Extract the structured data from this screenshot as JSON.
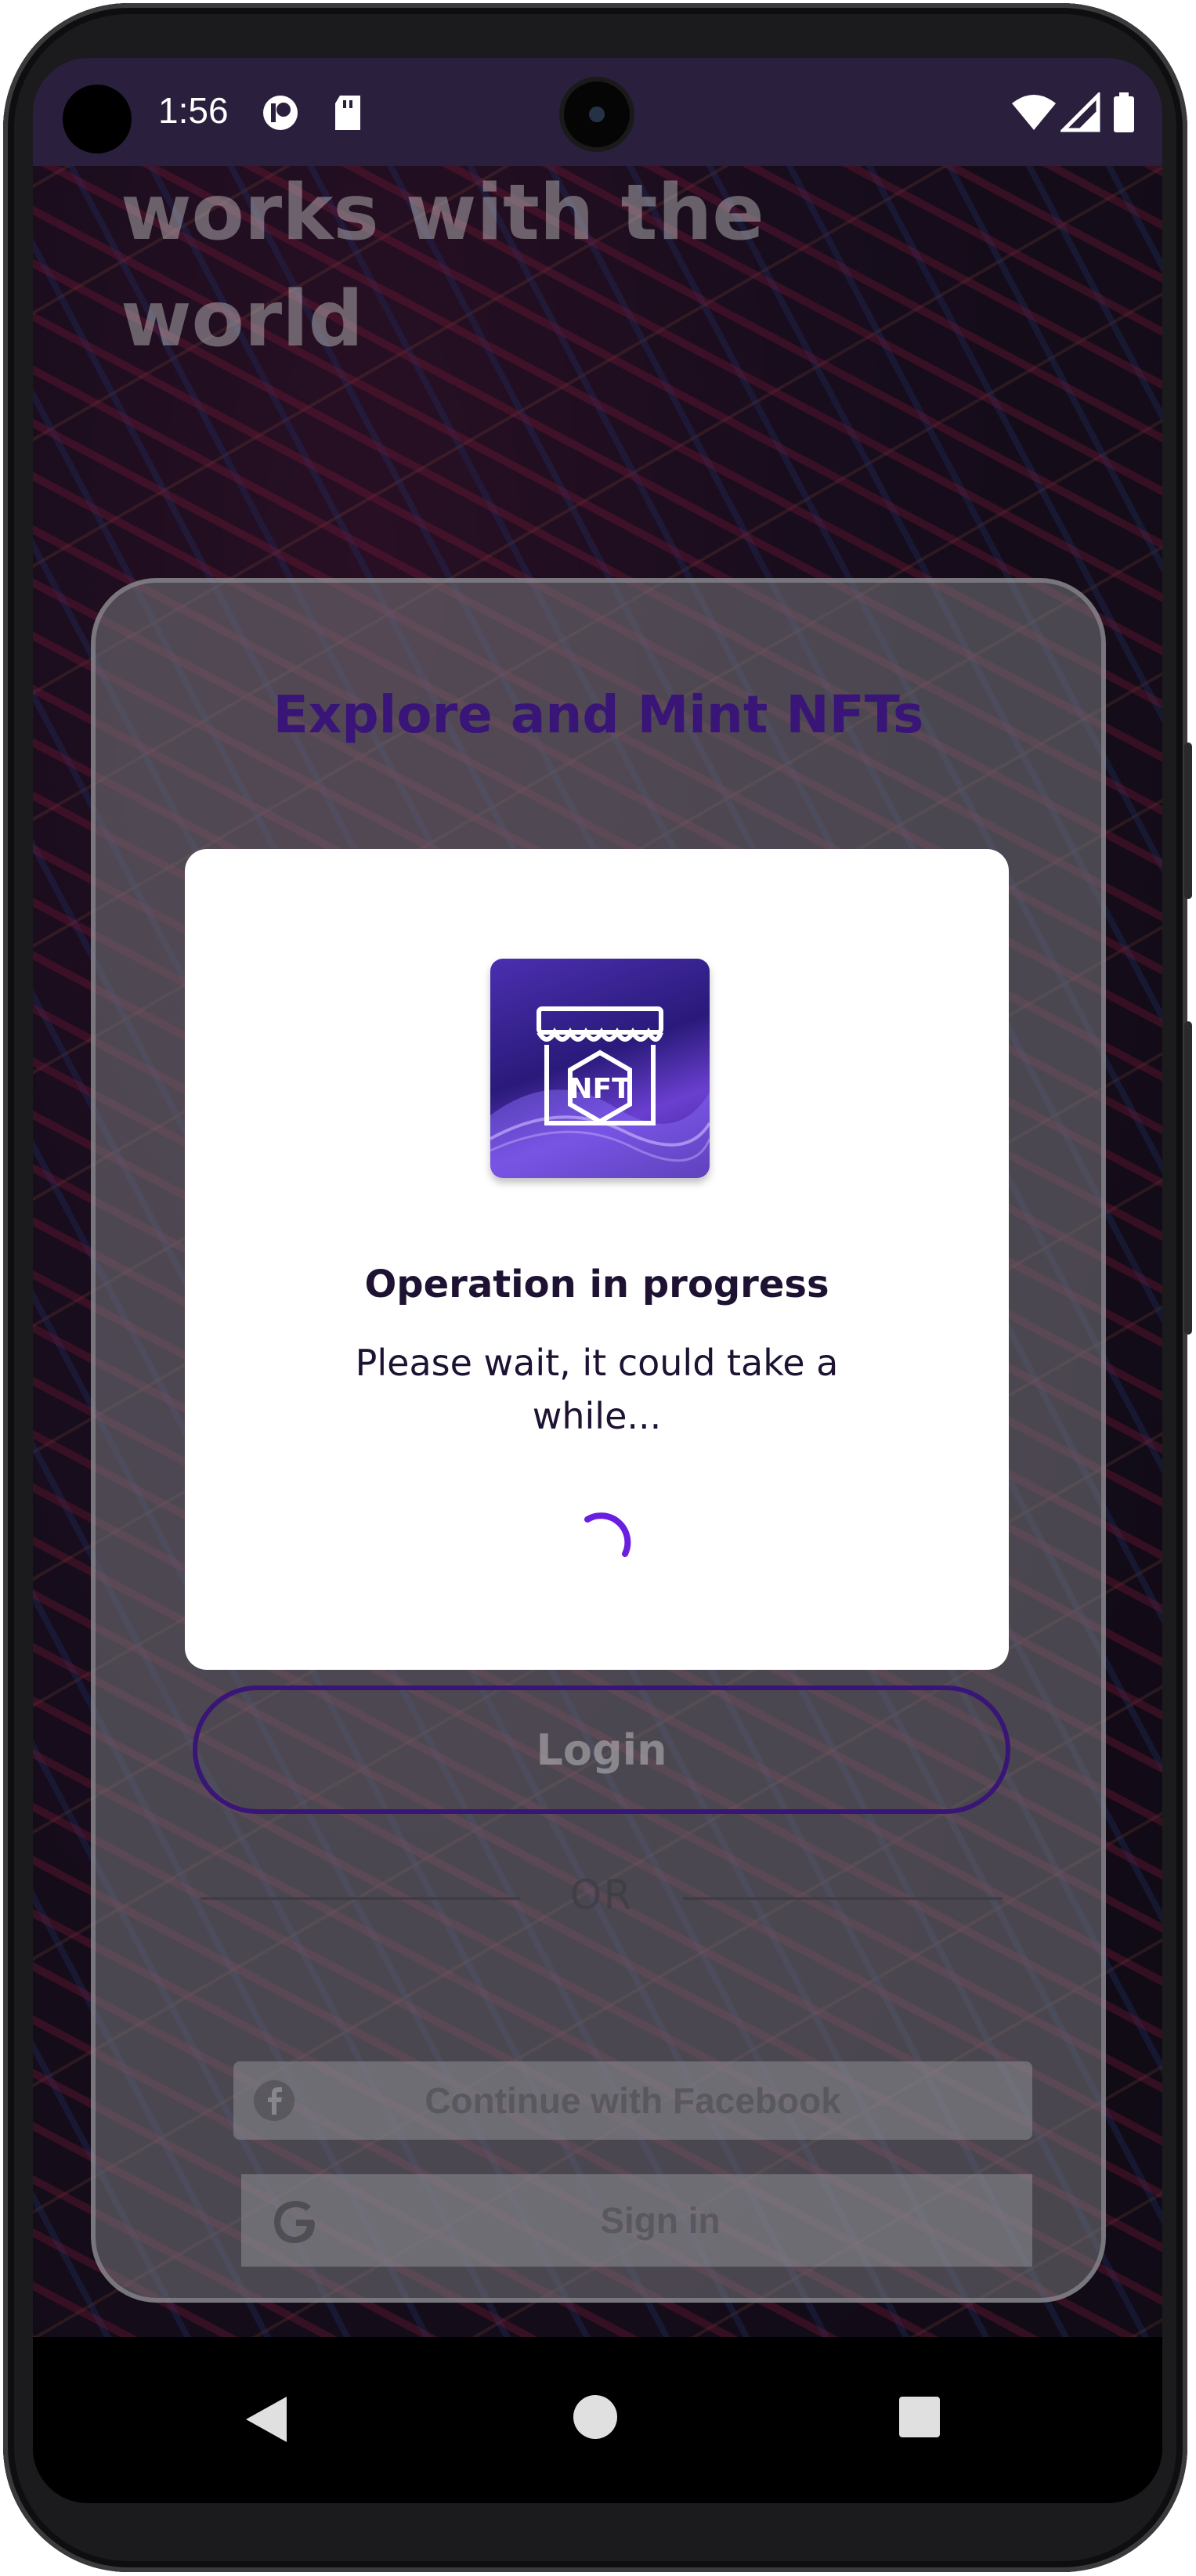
{
  "status_bar": {
    "time": "1:56",
    "icons": [
      "notification-app-icon",
      "sd-card-icon",
      "wifi-icon",
      "signal-icon",
      "battery-icon"
    ]
  },
  "hero": {
    "title_lines": [
      "works with the",
      "world"
    ]
  },
  "card": {
    "title": "Explore and Mint NFTs",
    "login_label": "Login",
    "or_label": "OR",
    "facebook_label": "Continue with Facebook",
    "google_label": "Sign in"
  },
  "dialog": {
    "logo_text": "NFT",
    "title": "Operation in progress",
    "message": "Please wait, it could take a while..."
  },
  "colors": {
    "accent": "#3a1578",
    "spinner": "#6a1fe0",
    "dialog_text": "#1e1233"
  }
}
